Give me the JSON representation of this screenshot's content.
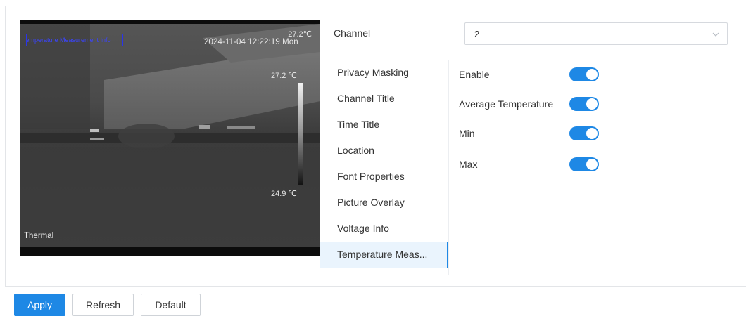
{
  "preview": {
    "osd_title": "Temperature Measurement Info",
    "osd_top_temp": "27.2℃",
    "osd_datetime": "2024-11-04 12:22:19 Mon",
    "scale_max": "27.2 ℃",
    "scale_min": "24.9 ℃",
    "osd_channel_name": "Thermal"
  },
  "channel": {
    "label": "Channel",
    "value": "2"
  },
  "menu": {
    "items": [
      {
        "label": "Privacy Masking"
      },
      {
        "label": "Channel Title"
      },
      {
        "label": "Time Title"
      },
      {
        "label": "Location"
      },
      {
        "label": "Font Properties"
      },
      {
        "label": "Picture Overlay"
      },
      {
        "label": "Voltage Info"
      },
      {
        "label": "Temperature Meas..."
      }
    ],
    "active": "Temperature Meas..."
  },
  "options": [
    {
      "label": "Enable",
      "enabled": true
    },
    {
      "label": "Average Temperature",
      "enabled": true
    },
    {
      "label": "Min",
      "enabled": true
    },
    {
      "label": "Max",
      "enabled": true
    }
  ],
  "buttons": {
    "apply": "Apply",
    "refresh": "Refresh",
    "default": "Default"
  },
  "colors": {
    "accent": "#1e88e5",
    "osd_box": "#2a34e8"
  }
}
